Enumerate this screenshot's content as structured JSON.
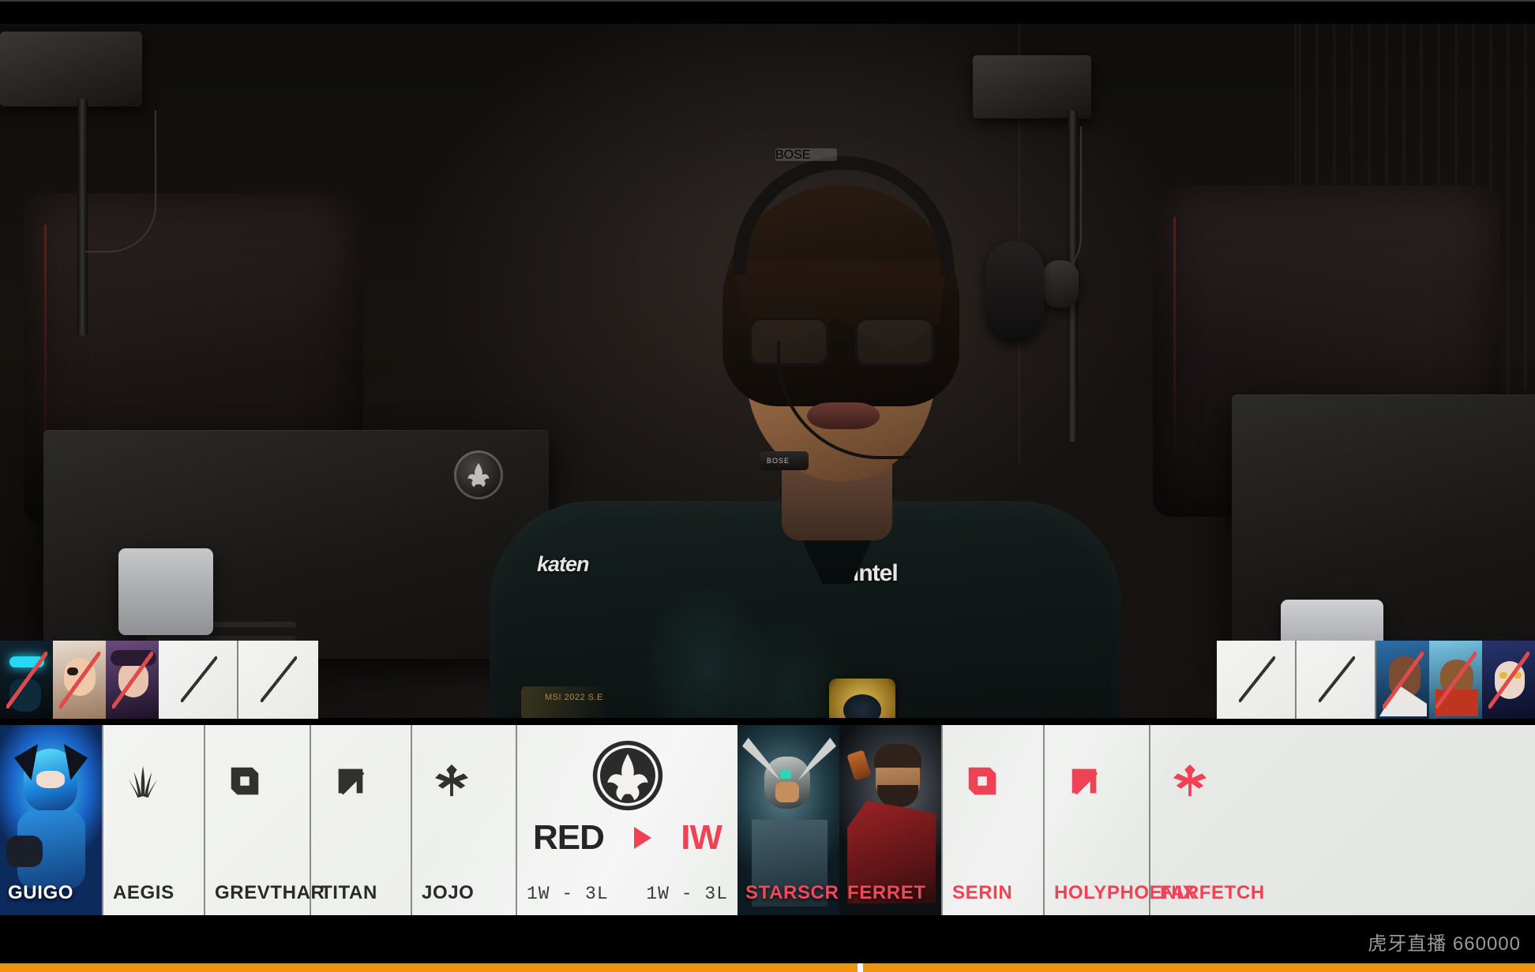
{
  "broadcast": {
    "event": "MSI 2022",
    "watermark": "虎牙直播 660000"
  },
  "video": {
    "jersey_sponsor_left": "katen",
    "jersey_sponsor_right": "intel",
    "jersey_patch_text": "MSI 2022 S.E",
    "headset_brand": "BOSE",
    "monitor_logo": "msi-emblem"
  },
  "scorebug": {
    "logo": "msi-emblem-icon",
    "home": {
      "code": "RED",
      "record": "1W - 3L"
    },
    "away": {
      "code": "IW",
      "record": "1W - 3L"
    },
    "arrow": "play-arrow-icon",
    "home_color": "#262626",
    "away_color": "#ef4355"
  },
  "bans": {
    "left": [
      {
        "champion": "nocturne",
        "state": "banned"
      },
      {
        "champion": "leblanc",
        "state": "banned"
      },
      {
        "champion": "caitlyn",
        "state": "banned"
      },
      {
        "champion": "",
        "state": "empty"
      },
      {
        "champion": "",
        "state": "empty"
      }
    ],
    "right": [
      {
        "champion": "",
        "state": "empty"
      },
      {
        "champion": "",
        "state": "empty"
      },
      {
        "champion": "lucian",
        "state": "banned"
      },
      {
        "champion": "wukong",
        "state": "banned"
      },
      {
        "champion": "ahri",
        "state": "banned"
      }
    ]
  },
  "blue_team": {
    "side": "blue",
    "players": [
      {
        "name": "GUIGO",
        "role": "top",
        "role_icon": "top-lane-icon",
        "has_splash": true,
        "champion": "gwen"
      },
      {
        "name": "AEGIS",
        "role": "jungle",
        "role_icon": "jungle-icon",
        "has_splash": false,
        "champion": ""
      },
      {
        "name": "GREVTHAR",
        "role": "mid",
        "role_icon": "mid-lane-icon",
        "has_splash": false,
        "champion": ""
      },
      {
        "name": "TITAN",
        "role": "bot",
        "role_icon": "bot-lane-icon",
        "has_splash": false,
        "champion": ""
      },
      {
        "name": "JOJO",
        "role": "support",
        "role_icon": "support-icon",
        "has_splash": false,
        "champion": ""
      }
    ]
  },
  "red_team": {
    "side": "red",
    "players": [
      {
        "name": "STARSCREEN",
        "role": "top",
        "role_icon": "top-lane-icon",
        "has_splash": true,
        "champion": "tryndamere"
      },
      {
        "name": "FERRET",
        "role": "jungle",
        "role_icon": "jungle-icon",
        "has_splash": true,
        "champion": "graves"
      },
      {
        "name": "SERIN",
        "role": "mid",
        "role_icon": "mid-lane-icon",
        "has_splash": false,
        "champion": ""
      },
      {
        "name": "HOLYPHOENIX",
        "role": "bot",
        "role_icon": "bot-lane-icon",
        "has_splash": false,
        "champion": ""
      },
      {
        "name": "FARFETCH",
        "role": "support",
        "role_icon": "support-icon",
        "has_splash": false,
        "champion": ""
      }
    ]
  },
  "player_bar": {
    "progress_percent": 56,
    "accent_color": "#f09410"
  }
}
